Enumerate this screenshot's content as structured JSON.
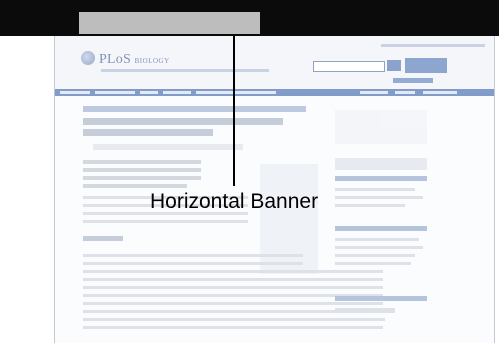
{
  "annotation": {
    "label": "Horizontal Banner"
  },
  "screenshot": {
    "logo_main": "PLoS",
    "logo_sub": "BIOLOGY"
  },
  "colors": {
    "banner_highlight": "#bdbdbd",
    "top_bar": "#0b0b0b",
    "nav_bar": "#6d8cc0",
    "callout": "#000000"
  }
}
